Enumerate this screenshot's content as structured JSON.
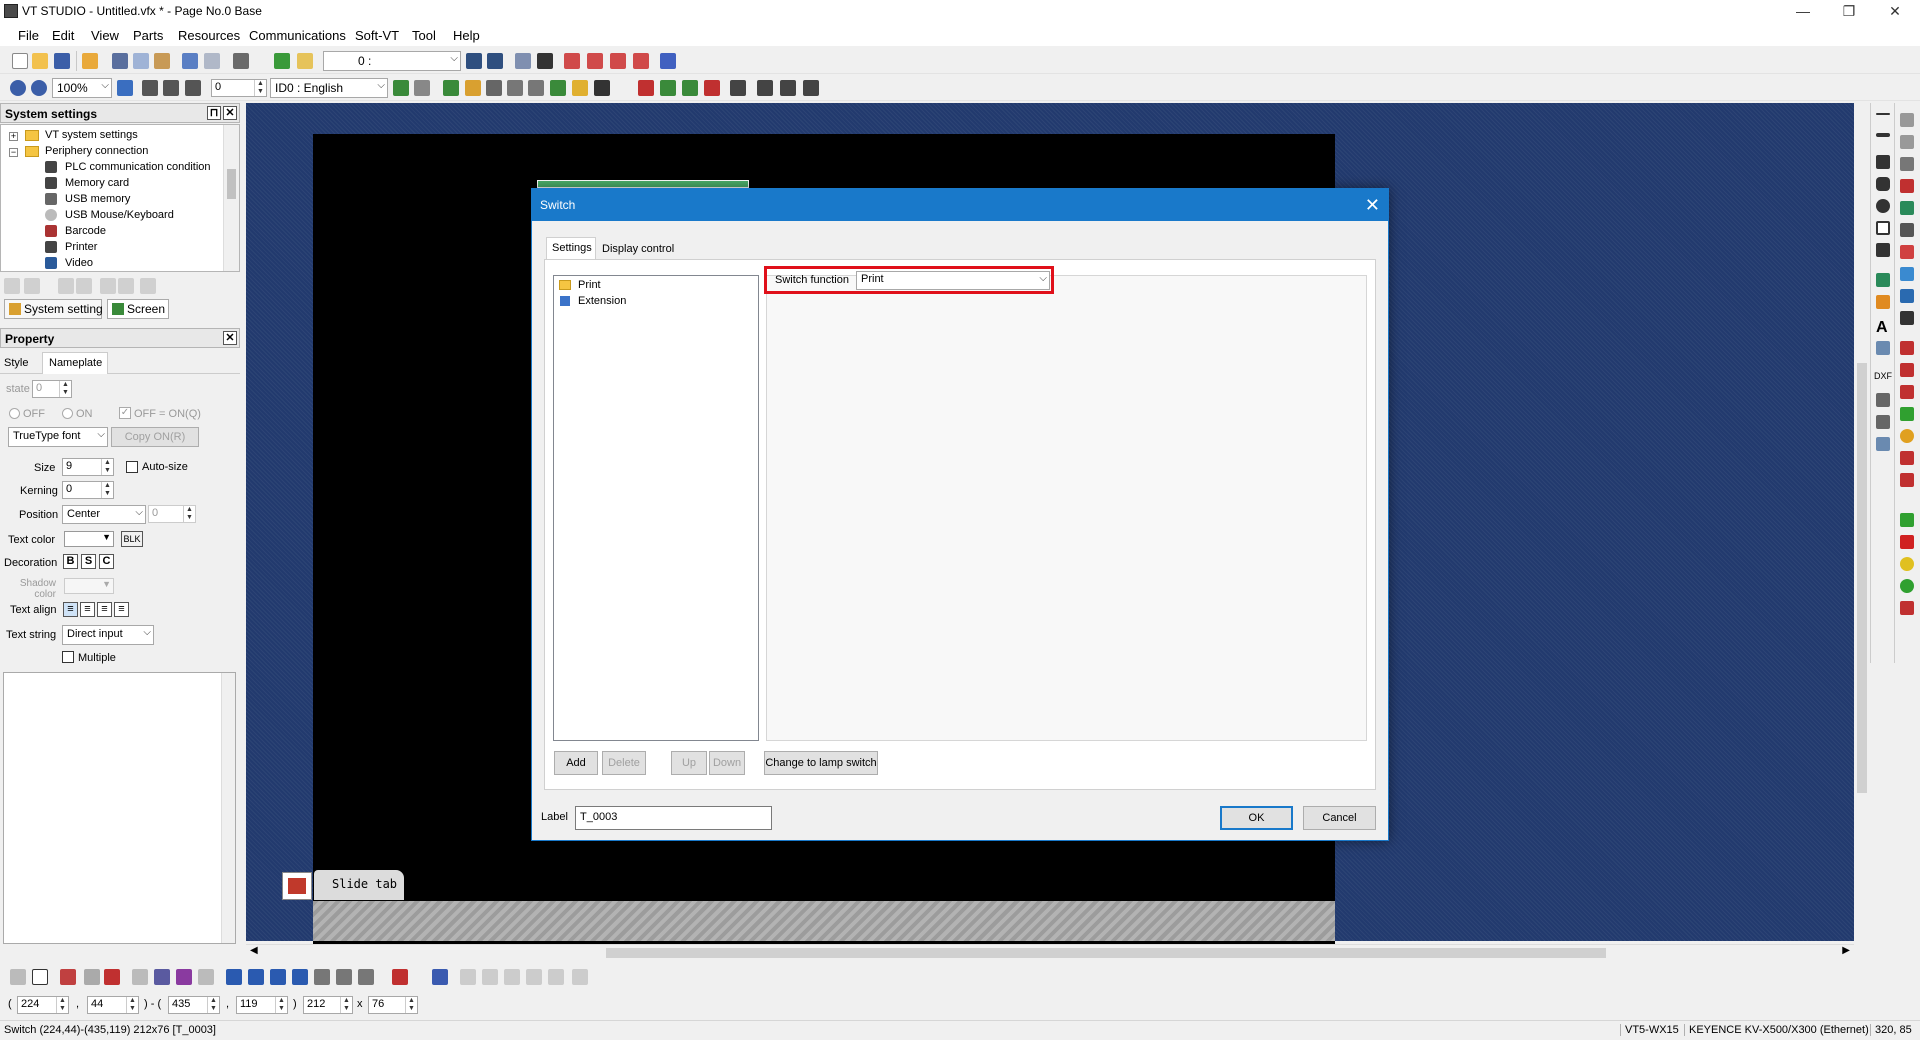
{
  "window": {
    "title": "VT STUDIO - Untitled.vfx * - Page No.0 Base",
    "minimize": "—",
    "restore": "❐",
    "close": "✕"
  },
  "menu": [
    "File",
    "Edit",
    "View",
    "Parts",
    "Resources",
    "Communications",
    "Soft-VT",
    "Tool",
    "Help"
  ],
  "toolbar1": {
    "page_combo": "0 :"
  },
  "toolbar2": {
    "zoom": "100%",
    "spin_value": "0",
    "language": "ID0 : English"
  },
  "system_settings": {
    "title": "System settings",
    "tree": [
      {
        "label": "VT system settings",
        "level": 0,
        "expander": "+"
      },
      {
        "label": "Periphery connection",
        "level": 0,
        "expander": "−"
      },
      {
        "label": "PLC communication condition",
        "level": 1
      },
      {
        "label": "Memory card",
        "level": 1
      },
      {
        "label": "USB memory",
        "level": 1
      },
      {
        "label": "USB Mouse/Keyboard",
        "level": 1
      },
      {
        "label": "Barcode",
        "level": 1
      },
      {
        "label": "Printer",
        "level": 1
      },
      {
        "label": "Video",
        "level": 1
      }
    ],
    "tab_system_setting": "System setting",
    "tab_screen": "Screen"
  },
  "property": {
    "title": "Property",
    "tabs": [
      "Style",
      "Nameplate"
    ],
    "state_label": "state",
    "state_value": "0",
    "off_label": "OFF",
    "on_label": "ON",
    "off_eq_on_label": "OFF = ON(Q)",
    "font_type": "TrueType font",
    "copy_button": "Copy ON(R)",
    "size_label": "Size",
    "size_value": "9",
    "auto_size_label": "Auto-size",
    "kerning_label": "Kerning",
    "kerning_value": "0",
    "position_label": "Position",
    "position_value": "Center",
    "position_offset": "0",
    "text_color_label": "Text color",
    "text_color_code": "BLK",
    "decoration_label": "Decoration",
    "decoration_bold": "B",
    "decoration_s": "S",
    "decoration_c": "C",
    "shadow_color_label": "Shadow color",
    "text_align_label": "Text align",
    "text_string_label": "Text string",
    "text_string_value": "Direct input",
    "multiple_label": "Multiple"
  },
  "canvas": {
    "slide_tab": "Slide tab"
  },
  "dialog": {
    "title": "Switch",
    "close": "✕",
    "tabs": [
      "Settings",
      "Display control"
    ],
    "function_list": [
      "Print",
      "Extension"
    ],
    "function_colors": [
      "#f5c542",
      "#3b73c9"
    ],
    "switch_function_label": "Switch function",
    "switch_function_value": "Print",
    "add_button": "Add",
    "delete_button": "Delete",
    "up_button": "Up",
    "down_button": "Down",
    "change_lamp_button": "Change to lamp switch",
    "label_caption": "Label",
    "label_value": "T_0003",
    "ok_button": "OK",
    "cancel_button": "Cancel",
    "highlight_color": "#e0101a"
  },
  "coords": {
    "open_paren": "(",
    "x1": "224",
    "comma1": ",",
    "y1": "44",
    "mid": ") - (",
    "x2": "435",
    "comma2": ",",
    "y2": "119",
    "close_paren": ")",
    "w": "212",
    "times": "x",
    "h": "76"
  },
  "status": {
    "left": "Switch (224,44)-(435,119) 212x76 [T_0003]",
    "model": "VT5-WX15",
    "plc": "KEYENCE KV-X500/X300 (Ethernet)",
    "cursor": "320, 85"
  }
}
